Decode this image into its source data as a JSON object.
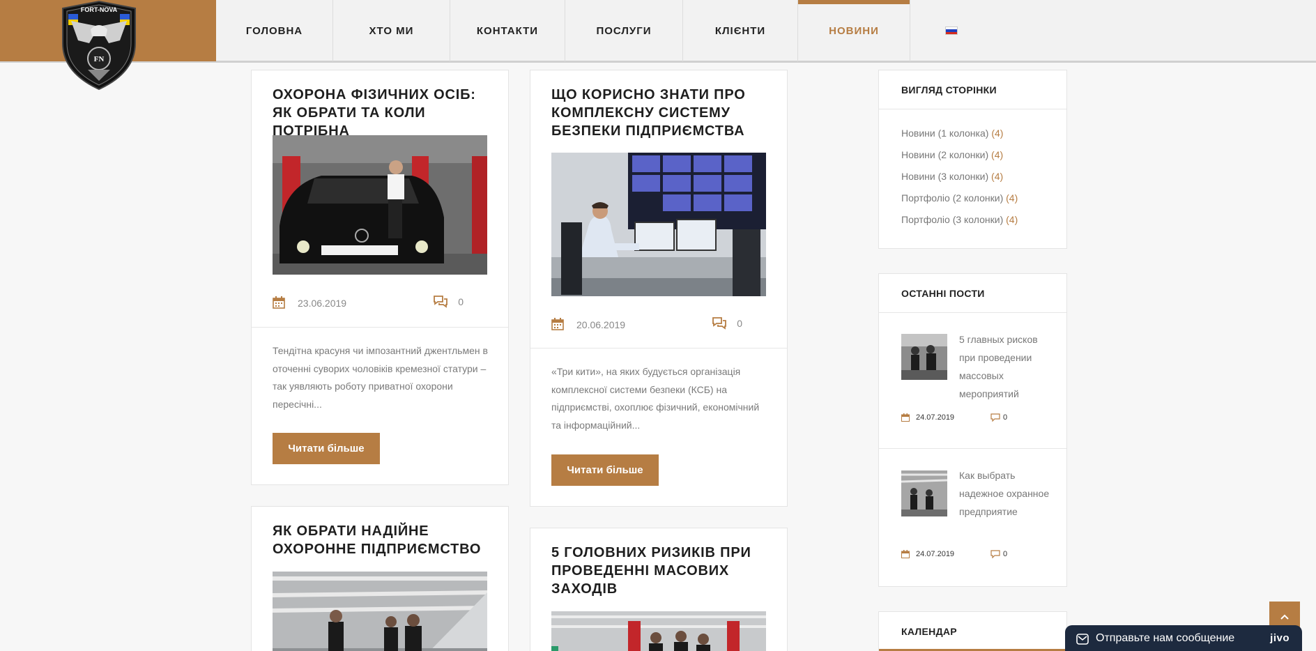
{
  "header": {
    "logo_text": "FORT-NOVA",
    "logo_initials": "FN",
    "nav": [
      {
        "label": "ГОЛОВНА",
        "active": false
      },
      {
        "label": "ХТО МИ",
        "active": false
      },
      {
        "label": "КОНТАКТИ",
        "active": false
      },
      {
        "label": "ПОСЛУГИ",
        "active": false
      },
      {
        "label": "КЛІЄНТИ",
        "active": false
      },
      {
        "label": "НОВИНИ",
        "active": true
      }
    ],
    "language_flag": "ru-flag-icon"
  },
  "posts": [
    {
      "title": "Охорона фізичних осіб: як обрати та коли потрібна",
      "date": "23.06.2019",
      "comments": "0",
      "excerpt": "Тендітна красуня чи імпозантний джентльмен в оточенні суворих чоловіків кремезної статури – так уявляють роботу приватної охорони пересічні...",
      "button": "Читати більше"
    },
    {
      "title": "Що корисно знати про комплексну систему безпеки підприємства",
      "date": "20.06.2019",
      "comments": "0",
      "excerpt": "«Три кити», на яких будується організація комплексної системи безпеки (КСБ) на підприємстві, охоплює фізичний, економічний та інформаційний...",
      "button": "Читати більше"
    },
    {
      "title": "Як обрати надійне охоронне підприємство"
    },
    {
      "title": "5 головних ризиків при проведенні масових заходів"
    }
  ],
  "sidebar": {
    "page_view": {
      "title": "ВИГЛЯД СТОРІНКИ",
      "items": [
        {
          "label": "Новини (1 колонка)",
          "count": "(4)"
        },
        {
          "label": "Новини (2 колонки)",
          "count": "(4)"
        },
        {
          "label": "Новини (3 колонки)",
          "count": "(4)"
        },
        {
          "label": "Портфоліо (2 колонки)",
          "count": "(4)"
        },
        {
          "label": "Портфоліо (3 колонки)",
          "count": "(4)"
        }
      ]
    },
    "recent_posts": {
      "title": "ОСТАННІ ПОСТИ",
      "items": [
        {
          "title": "5 главных рисков при проведении массовых мероприятий",
          "date": "24.07.2019",
          "comments": "0"
        },
        {
          "title": "Как выбрать надежное охранное предприятие",
          "date": "24.07.2019",
          "comments": "0"
        }
      ]
    },
    "calendar": {
      "title": "КАЛЕНДАР"
    }
  },
  "chat": {
    "text": "Отправьте нам сообщение",
    "brand": "jivo"
  },
  "colors": {
    "accent": "#b67d43",
    "chat_bg": "#1d2a3f"
  }
}
